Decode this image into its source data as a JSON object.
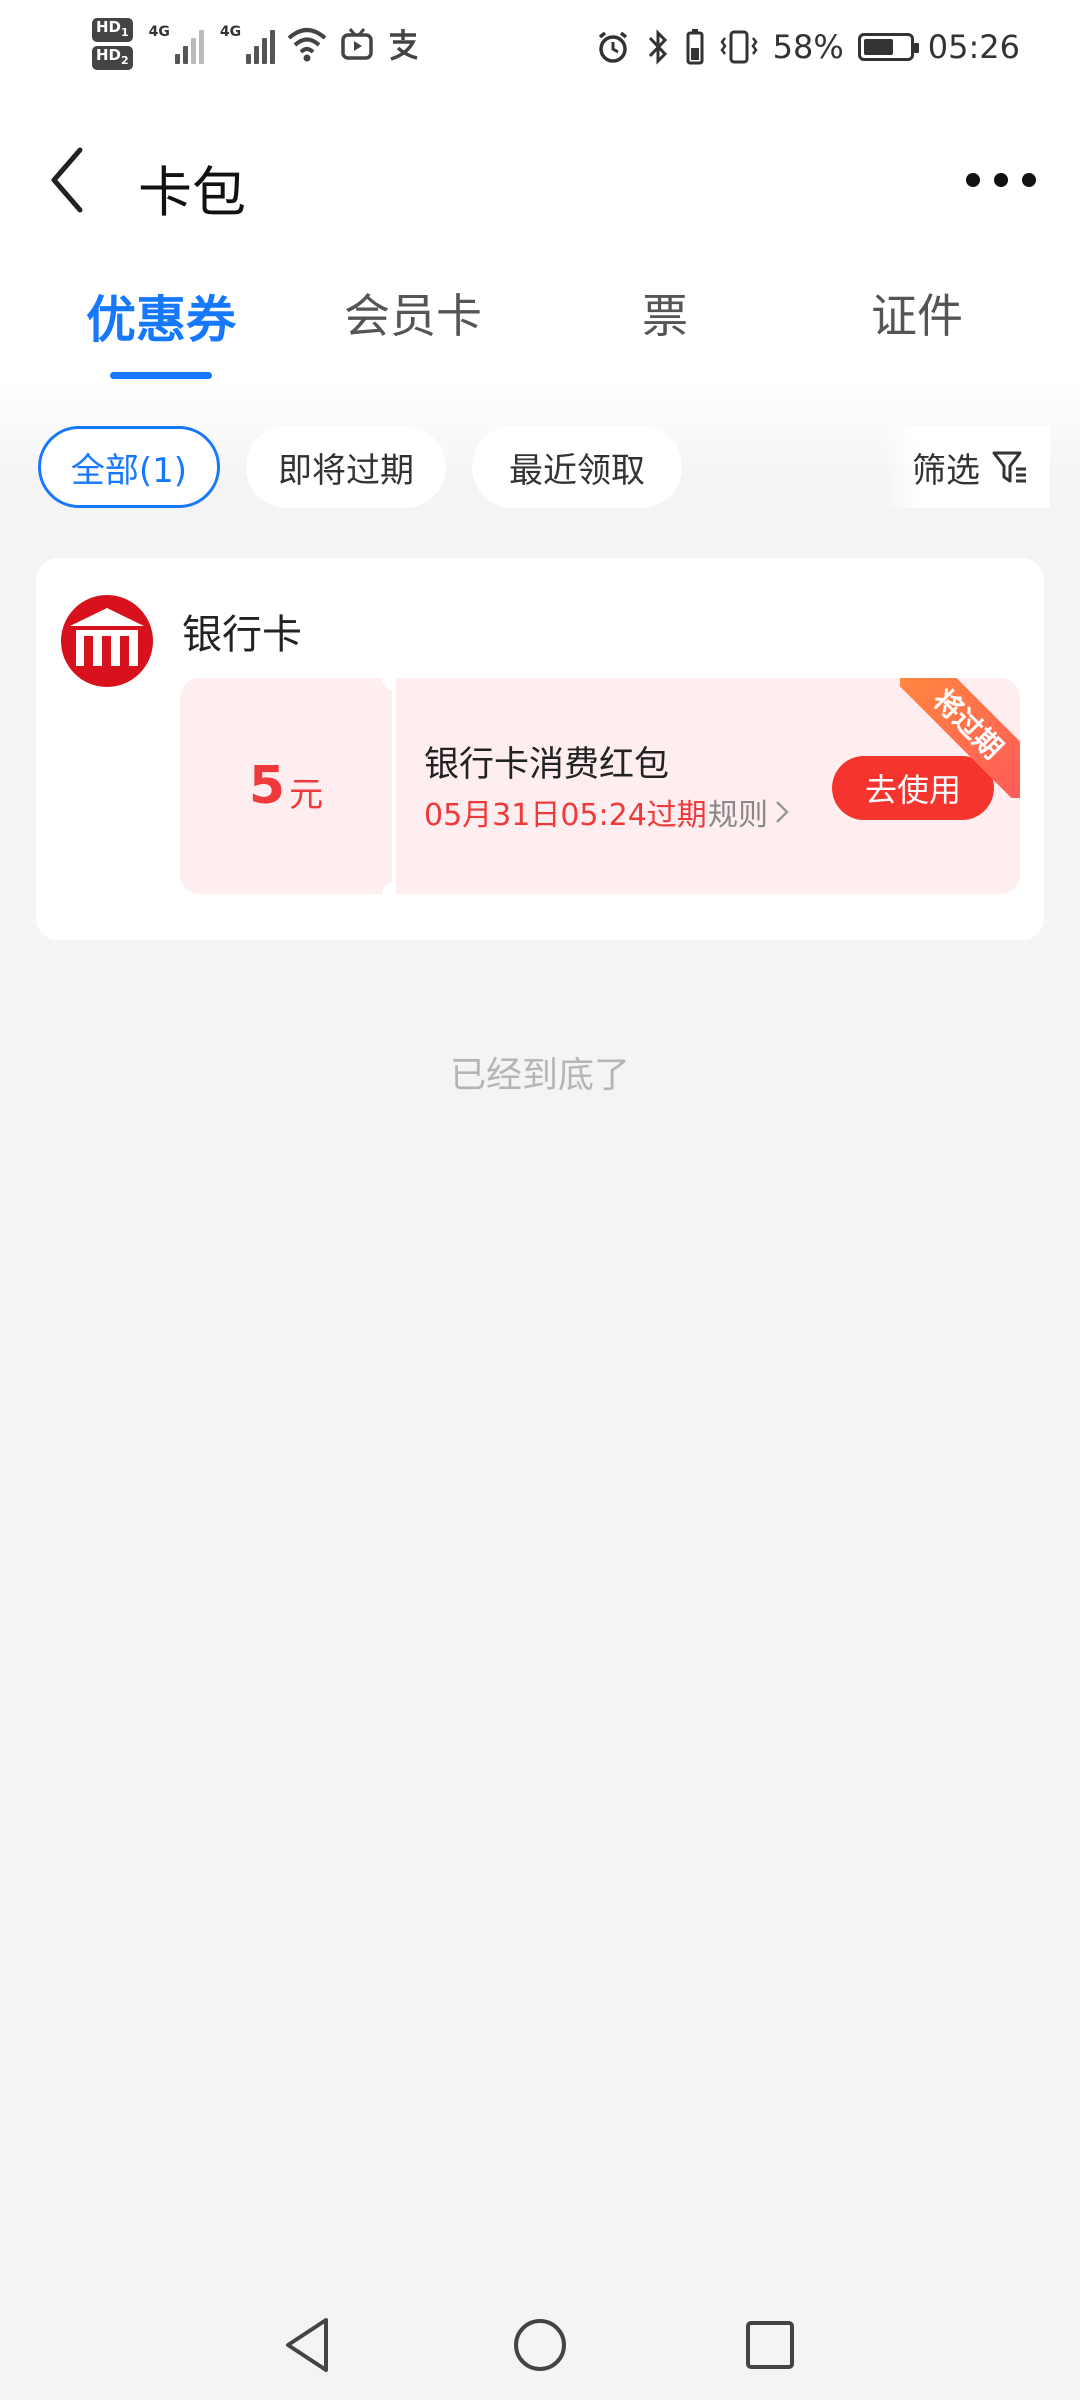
{
  "status_bar": {
    "hd1": "HD",
    "hd1_sub": "1",
    "hd2": "HD",
    "hd2_sub": "2",
    "net1": "4G",
    "net2": "4G",
    "battery": "58%",
    "time": "05:26"
  },
  "header": {
    "title": "卡包"
  },
  "tabs": [
    {
      "label": "优惠券",
      "active": true
    },
    {
      "label": "会员卡",
      "active": false
    },
    {
      "label": "票",
      "active": false
    },
    {
      "label": "证件",
      "active": false
    }
  ],
  "filters": {
    "chips": [
      {
        "label": "全部(1)",
        "active": true
      },
      {
        "label": "即将过期",
        "active": false
      },
      {
        "label": "最近领取",
        "active": false
      }
    ],
    "filter_label": "筛选"
  },
  "card": {
    "name": "银行卡",
    "coupon": {
      "amount": "5",
      "unit": "元",
      "title": "银行卡消费红包",
      "expire": "05月31日05:24过期",
      "rules": "规则",
      "use_label": "去使用",
      "ribbon": "将过期"
    }
  },
  "footer": {
    "end_text": "已经到底了"
  },
  "colors": {
    "accent": "#1677ff",
    "coupon_red": "#f0393a",
    "coupon_bg": "#ffeef0",
    "use_button": "#f5352d"
  }
}
